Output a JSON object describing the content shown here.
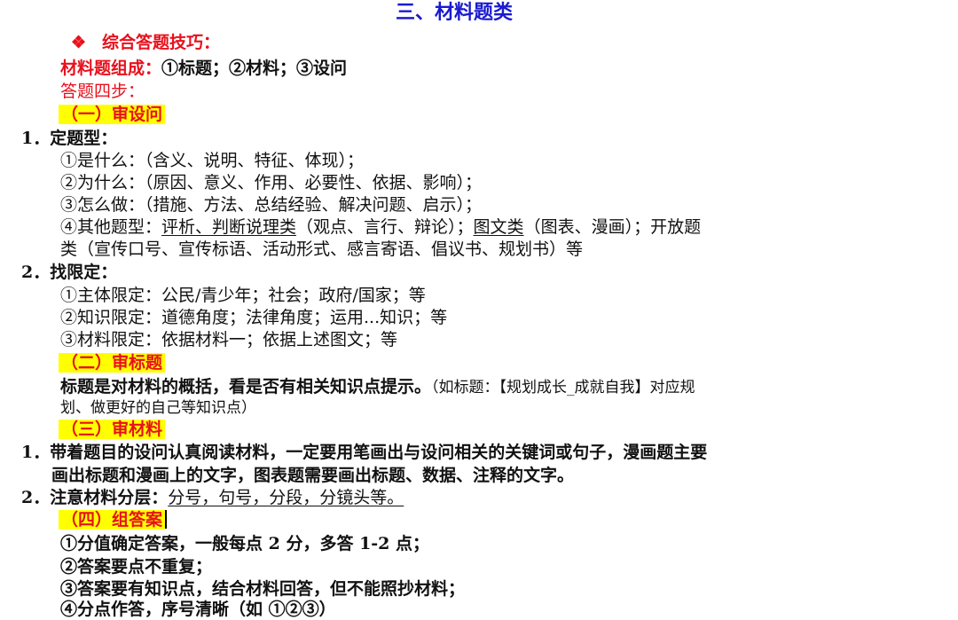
{
  "title": "三、材料题类",
  "bullet": "❖",
  "section_title": "综合答题技巧：",
  "composition": {
    "label": "材料题组成：",
    "text": "①标题；②材料；③设问"
  },
  "steps_label": "答题四步：",
  "s1": {
    "heading": "（一）审设问",
    "p1_num": "1．",
    "p1_label": "定题型：",
    "i1": "①是什么：（含义、说明、特征、体现）；",
    "i2": "②为什么：（原因、意义、作用、必要性、依据、影响）；",
    "i3": "③怎么做：（措施、方法、总结经验、解决问题、启示）；",
    "i4_a": "④其他题型：",
    "i4_b": "评析、判断说理类",
    "i4_c": "（观点、言行、辩论）；",
    "i4_d": "图文类",
    "i4_e": "（图表、漫画）；开放题",
    "i4_f": "类（宣传口号、宣传标语、活动形式、感言寄语、倡议书、规划书）等",
    "p2_num": "2．",
    "p2_label": "找限定：",
    "j1": "①主体限定：公民/青少年；社会；政府/国家；等",
    "j2": "②知识限定：道德角度；法律角度；运用...知识；等",
    "j3": "③材料限定：依据材料一；依据上述图文；等"
  },
  "s2": {
    "heading": "（二）审标题",
    "line1_a": "标题是对材料的概括，看是否有相关知识点提示。",
    "line1_b": "（如标题：【规划成长_成就自我】对应规",
    "line2": "划、做更好的自己等知识点）"
  },
  "s3": {
    "heading": "（三）审材料",
    "p1_num": "1．",
    "p1_a": "带着题目的设问认真阅读材料，一定要用笔画出与设问相关的关键词或句子，漫画题主要",
    "p1_b": "画出标题和漫画上的文字，图表题需要画出标题、数据、注释的文字。",
    "p2_num": "2．",
    "p2_label": "注意材料分层：",
    "p2_text": "分号，句号，分段，分镜头等。"
  },
  "s4": {
    "heading": "（四）组答案",
    "k1": "①分值确定答案，一般每点 2 分，多答 1-2 点；",
    "k2": "②答案要点不重复；",
    "k3": "③答案要有知识点，结合材料回答，但不能照抄材料；",
    "k4": "④分点作答，序号清晰（如 ①②③）"
  }
}
